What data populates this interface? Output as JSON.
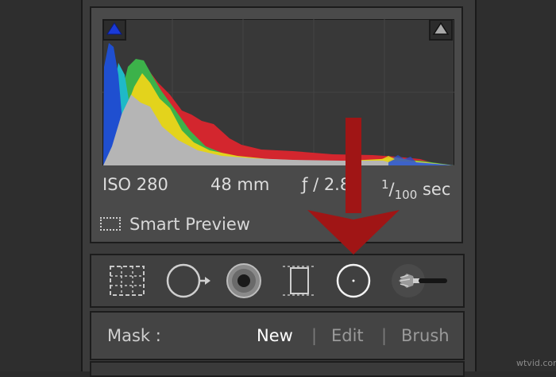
{
  "histogram": {
    "clip_shadow_icon": "shadow-clipping-triangle-icon",
    "clip_highlight_icon": "highlight-clipping-triangle-icon",
    "colors": {
      "blue": "#1f4fd0",
      "cyan": "#1fb9c7",
      "green": "#3cb24a",
      "yellow": "#e3d31c",
      "red": "#d3262e",
      "gray": "#b5b5b5"
    }
  },
  "exif": {
    "iso": "ISO 280",
    "focal_length": "48 mm",
    "aperture": "ƒ / 2.8",
    "shutter_num": "1",
    "shutter_den": "100",
    "shutter_unit": "sec"
  },
  "smart_preview": {
    "label": "Smart Preview",
    "icon": "smart-preview-icon"
  },
  "tools": [
    {
      "name": "crop-overlay-tool",
      "icon": "crop-icon"
    },
    {
      "name": "spot-removal-tool",
      "icon": "spot-removal-icon"
    },
    {
      "name": "red-eye-tool",
      "icon": "eye-icon"
    },
    {
      "name": "graduated-filter-tool",
      "icon": "graduated-filter-icon"
    },
    {
      "name": "radial-filter-tool",
      "icon": "radial-filter-icon"
    },
    {
      "name": "adjustment-brush-tool",
      "icon": "brush-icon"
    }
  ],
  "mask": {
    "label": "Mask :",
    "new": "New",
    "edit": "Edit",
    "brush": "Brush",
    "separator": "|"
  },
  "overlay": {
    "arrow_color": "#a01515"
  },
  "watermark": "wtvid.com"
}
